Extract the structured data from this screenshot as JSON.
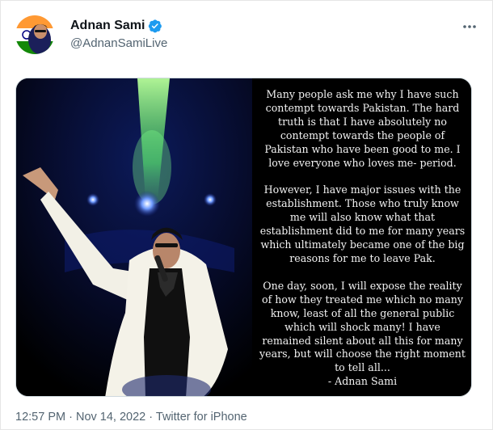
{
  "tweet": {
    "display_name": "Adnan Sami",
    "handle": "@AdnanSamiLive",
    "more_icon": "more-horizontal-icon",
    "verified_icon": "verified-badge-icon",
    "verified_color": "#1d9bf0",
    "image": {
      "quote_paragraphs": [
        "Many people ask me why I have such contempt towards Pakistan. The hard truth is that I have absolutely no contempt towards the people of Pakistan who have been good to me. I love everyone who loves me- period.",
        "However, I have major issues with the establishment. Those who truly know me will also know what that establishment did to me for many years which ultimately became one of the big reasons for me to leave Pak.",
        "One day, soon, I will expose the reality of how they treated me which no many know, least of all the general public which will shock many! I have remained silent about all this for many years, but will choose the right moment to tell all..."
      ],
      "quote_signature": "- Adnan Sami"
    },
    "time": "12:57 PM",
    "separator": "·",
    "date": "Nov 14, 2022",
    "source": "Twitter for iPhone"
  }
}
